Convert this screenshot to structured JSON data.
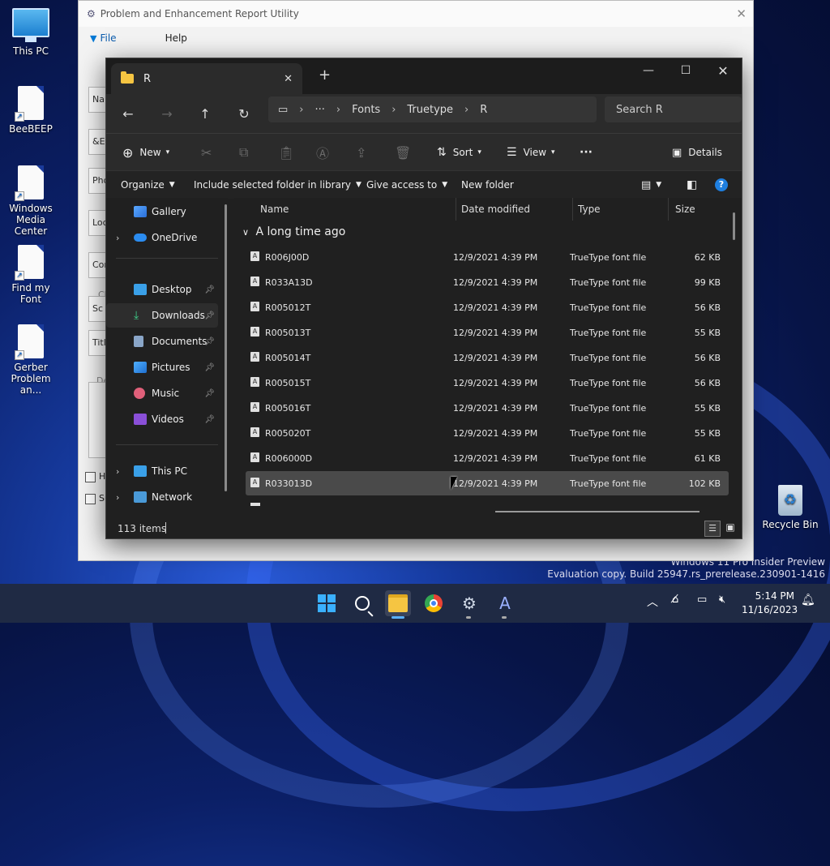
{
  "desktop": {
    "icons": [
      {
        "label": "This PC"
      },
      {
        "label": "BeeBEEP"
      },
      {
        "label": "Windows Media Center"
      },
      {
        "label": "Find my Font"
      },
      {
        "label": "Gerber Problem an..."
      },
      {
        "label": "Recycle Bin"
      }
    ],
    "watermark": {
      "line1": "Windows 11 Pro Insider Preview",
      "line2": "Evaluation copy. Build 25947.rs_prerelease.230901-1416"
    }
  },
  "bg_app": {
    "title": "Problem and Enhancement Report Utility",
    "menu": [
      "File",
      "Help"
    ],
    "field_fragments": [
      "Na",
      "&E",
      "Pho",
      "Loc",
      "Cor",
      "Cl",
      "Sc",
      "Title",
      "De",
      "Ha",
      "Su"
    ]
  },
  "explorer": {
    "tab_title": "R",
    "new_tab": "+",
    "address": {
      "more": "···",
      "crumbs": [
        "Fonts",
        "Truetype",
        "R"
      ]
    },
    "search_placeholder": "Search R",
    "commands": {
      "new": "New",
      "sort": "Sort",
      "view": "View",
      "more": "···",
      "details": "Details"
    },
    "legacy": {
      "organize": "Organize",
      "include": "Include selected folder in library",
      "give_access": "Give access to",
      "new_folder": "New folder",
      "help": "?"
    },
    "nav": {
      "gallery": "Gallery",
      "onedrive": "OneDrive",
      "desktop": "Desktop",
      "downloads": "Downloads",
      "documents": "Documents",
      "pictures": "Pictures",
      "music": "Music",
      "videos": "Videos",
      "thispc": "This PC",
      "network": "Network"
    },
    "columns": {
      "name": "Name",
      "date": "Date modified",
      "type": "Type",
      "size": "Size"
    },
    "group_label": "A long time ago",
    "files": [
      {
        "name": "R006J00D",
        "date": "12/9/2021 4:39 PM",
        "type": "TrueType font file",
        "size": "62 KB"
      },
      {
        "name": "R033A13D",
        "date": "12/9/2021 4:39 PM",
        "type": "TrueType font file",
        "size": "99 KB"
      },
      {
        "name": "R005012T",
        "date": "12/9/2021 4:39 PM",
        "type": "TrueType font file",
        "size": "56 KB"
      },
      {
        "name": "R005013T",
        "date": "12/9/2021 4:39 PM",
        "type": "TrueType font file",
        "size": "55 KB"
      },
      {
        "name": "R005014T",
        "date": "12/9/2021 4:39 PM",
        "type": "TrueType font file",
        "size": "56 KB"
      },
      {
        "name": "R005015T",
        "date": "12/9/2021 4:39 PM",
        "type": "TrueType font file",
        "size": "56 KB"
      },
      {
        "name": "R005016T",
        "date": "12/9/2021 4:39 PM",
        "type": "TrueType font file",
        "size": "55 KB"
      },
      {
        "name": "R005020T",
        "date": "12/9/2021 4:39 PM",
        "type": "TrueType font file",
        "size": "55 KB"
      },
      {
        "name": "R006000D",
        "date": "12/9/2021 4:39 PM",
        "type": "TrueType font file",
        "size": "61 KB"
      },
      {
        "name": "R033013D",
        "date": "12/9/2021 4:39 PM",
        "type": "TrueType font file",
        "size": "102 KB"
      }
    ],
    "selected_index": 9,
    "status": "113 items"
  },
  "taskbar": {
    "time": "5:14 PM",
    "date": "11/16/2023"
  },
  "colors": {
    "accent": "#0078d4",
    "folder": "#f5c542",
    "window_bg": "#202020",
    "toolbar_bg": "#2b2b2b"
  }
}
